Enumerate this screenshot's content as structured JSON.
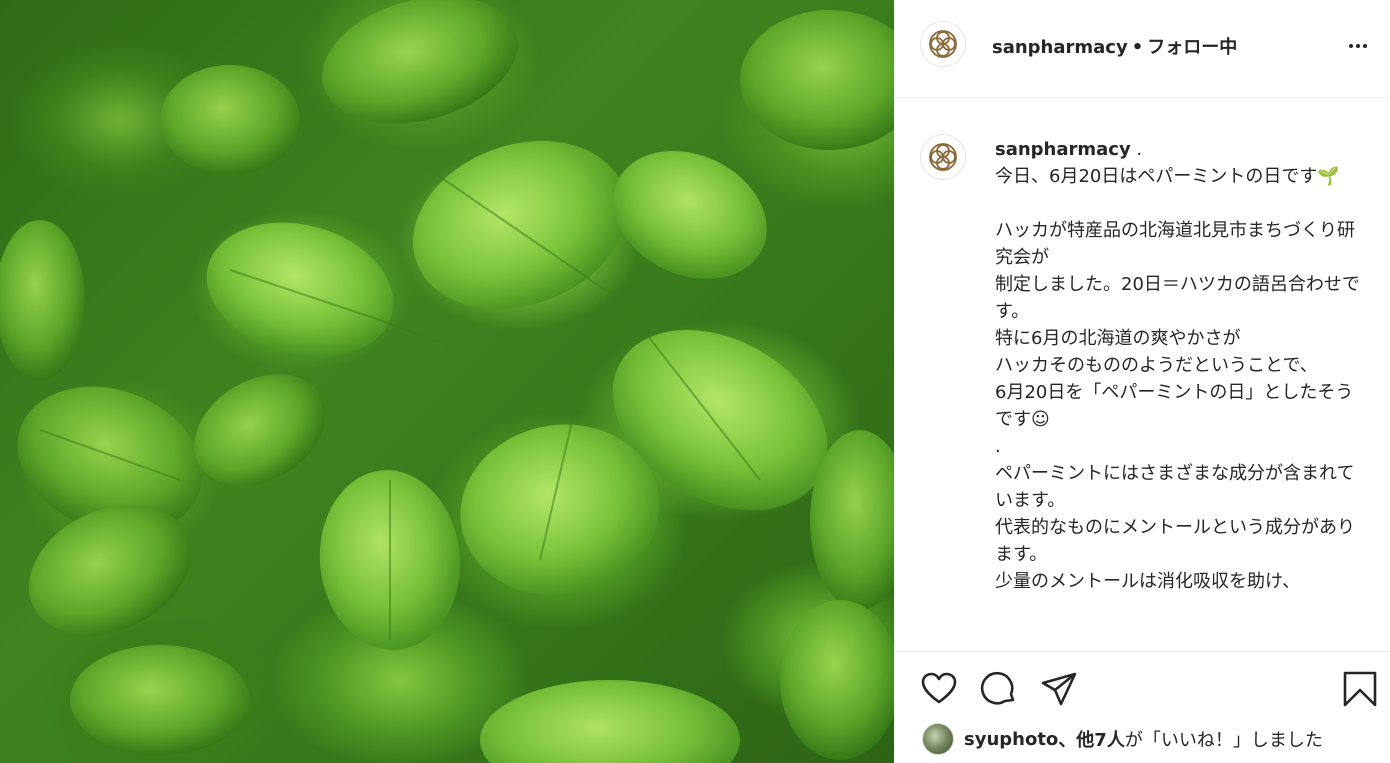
{
  "post": {
    "username": "sanpharmacy",
    "separator": "•",
    "follow_status": "フォロー中"
  },
  "caption": {
    "username": "sanpharmacy",
    "username_suffix": " .",
    "lines": [
      "今日、6月20日はペパーミントの日です🌱",
      "",
      "ハッカが特産品の北海道北見市まちづくり研究会が",
      "制定しました。20日＝ハツカの語呂合わせです。",
      "特に6月の北海道の爽やかさが",
      "ハッカそのもののようだということで、",
      "6月20日を「ペパーミントの日」としたそうです☺",
      ".",
      "ペパーミントにはさまざまな成分が含まれています。",
      "代表的なものにメントールという成分があります。",
      "少量のメントールは消化吸収を助け、"
    ]
  },
  "likes": {
    "first_liker": "syuphoto",
    "others": "、他7人",
    "suffix": "が「いいね！」しました"
  },
  "icons": {
    "avatar": "logo-icon",
    "more": "more-options-icon",
    "like": "heart-icon",
    "comment": "comment-icon",
    "share": "share-icon",
    "save": "bookmark-icon"
  },
  "colors": {
    "text": "#262626",
    "border": "#efefef",
    "logo": "#8a6a3a",
    "leaf": "#6fb836"
  }
}
